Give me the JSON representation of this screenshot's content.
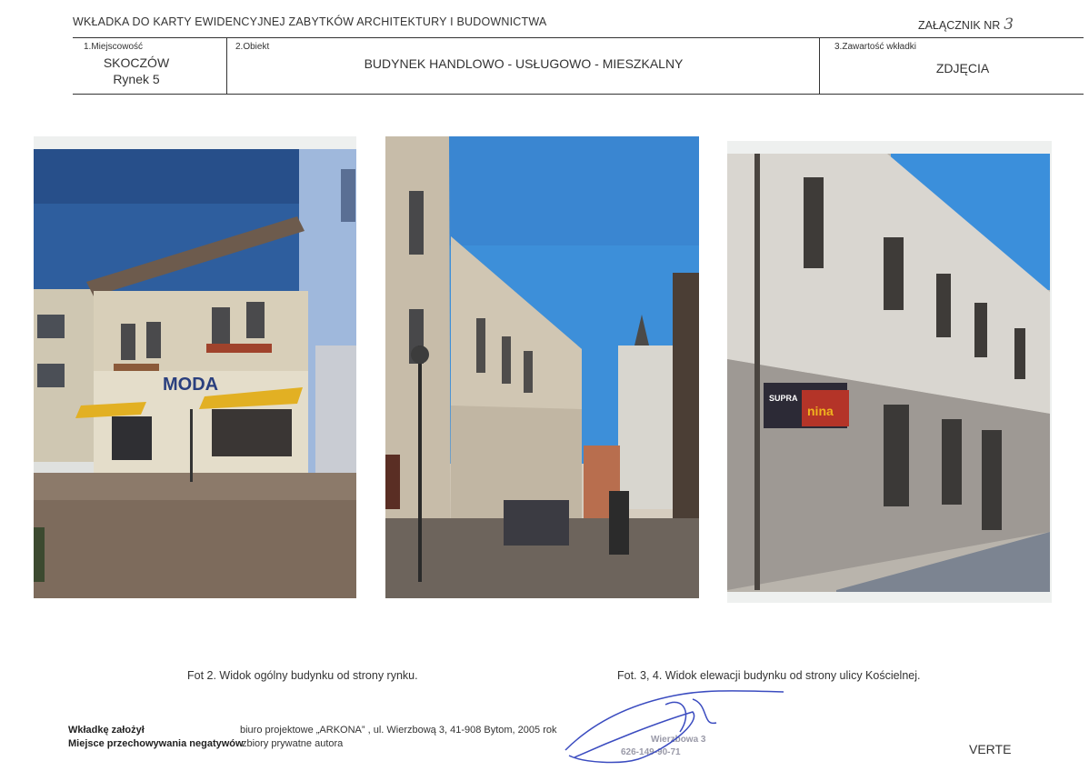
{
  "header": {
    "title": "WKŁADKA DO KARTY EWIDENCYJNEJ ZABYTKÓW ARCHITEKTURY I BUDOWNICTWA",
    "annex_label": "ZAŁĄCZNIK NR",
    "annex_number": "3"
  },
  "table": {
    "locality_label": "1.Miejscowość",
    "locality_line1": "SKOCZÓW",
    "locality_line2": "Rynek 5",
    "object_label": "2.Obiekt",
    "object_value": "BUDYNEK HANDLOWO - USŁUGOWO - MIESZKALNY",
    "contents_label": "3.Zawartość wkładki",
    "contents_value": "ZDJĘCIA"
  },
  "photos": {
    "photo1_sign": "MODA",
    "photo3_sign_left": "SUPRA",
    "photo3_sign_right": "nina"
  },
  "captions": {
    "left": "Fot 2. Widok ogólny budynku od strony rynku.",
    "right": "Fot. 3, 4. Widok elewacji budynku od strony ulicy Kościelnej."
  },
  "footer": {
    "founded_label": "Wkładkę założył",
    "founded_value": "biuro projektowe  „ARKONA” , ul. Wierzbową 3, 41-908 Bytom, 2005 rok",
    "storage_label": "Miejsce przechowywania negatywów",
    "storage_value": "zbiory prywatne autora",
    "stamp_line1": "Wierzbowa 3",
    "stamp_line2": "626-149-90-71",
    "verte": "VERTE"
  },
  "colors": {
    "sky": "#2f63a8",
    "ink_signature": "#3b4cc0"
  }
}
